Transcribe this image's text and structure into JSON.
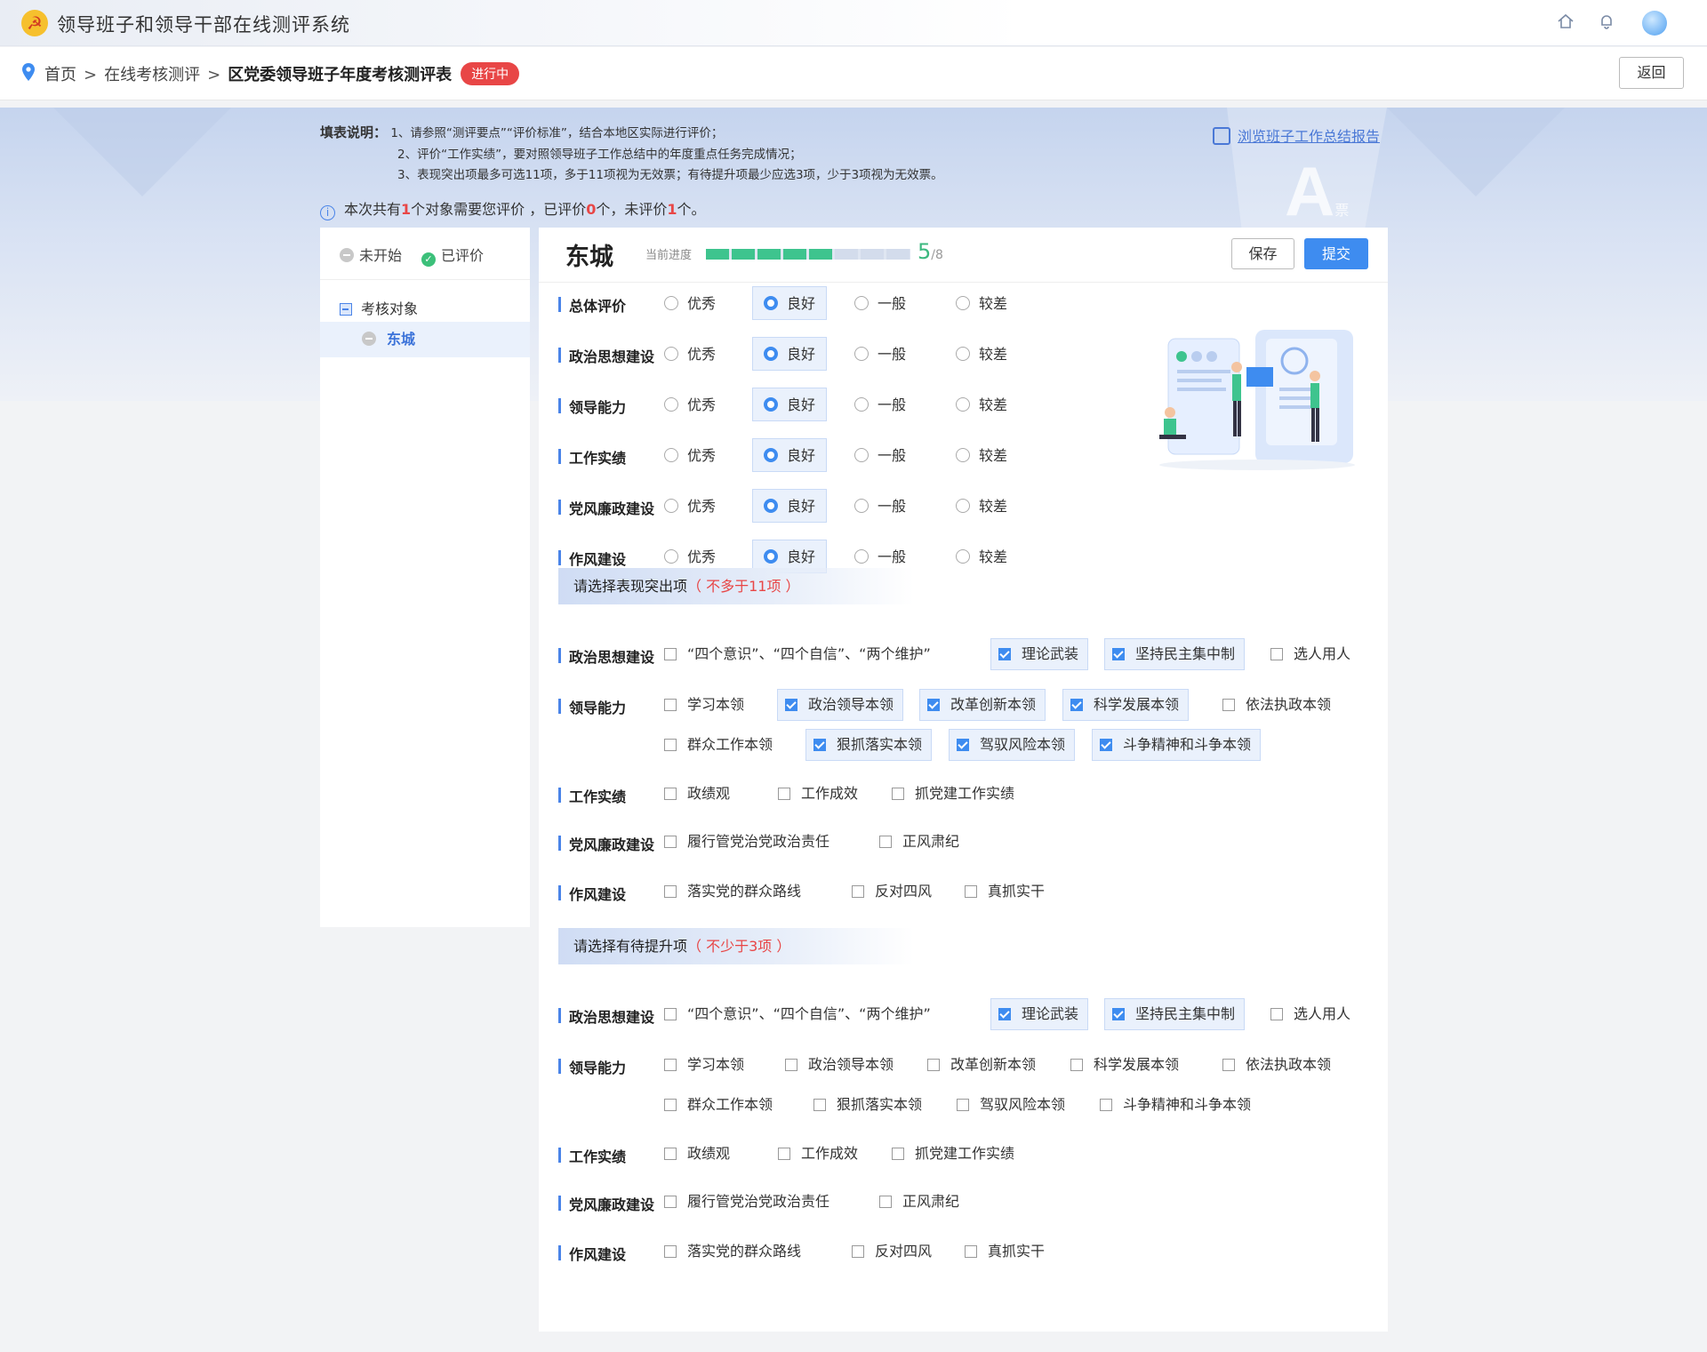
{
  "app": {
    "title": "领导班子和领导干部在线测评系统"
  },
  "breadcrumb": {
    "items": [
      "首页",
      "在线考核测评",
      "区党委领导班子年度考核测评表"
    ],
    "separator": ">",
    "status_badge": "进行中",
    "back_label": "返回"
  },
  "instructions": {
    "lead": "填表说明：",
    "lines": [
      "1、请参照“测评要点”“评价标准”，结合本地区实际进行评价；",
      "2、评价“工作实绩”，要对照领导班子工作总结中的年度重点任务完成情况；",
      "3、表现突出项最多可选11项，多于11项视为无效票；有待提升项最少应选3项，少于3项视为无效票。"
    ],
    "report_link": "浏览班子工作总结报告",
    "watermark": "A",
    "watermark_sub": "票"
  },
  "summary": {
    "prefix": "本次共有",
    "total": "1",
    "mid1": "个对象需要您评价 ，已评价",
    "done": "0",
    "mid2": "个，未评价",
    "todo": "1",
    "suffix": "个。"
  },
  "sidebar": {
    "legend_not_started": "未开始",
    "legend_evaluated": "已评价",
    "tree_root": "考核对象",
    "tree_item": "东城"
  },
  "panel": {
    "subject_name": "东城",
    "progress_label": "当前进度",
    "progress_value": "5",
    "progress_total": "/8",
    "progress_fraction": 0.625,
    "save_label": "保存",
    "submit_label": "提交"
  },
  "ratings": {
    "options": [
      "优秀",
      "良好",
      "一般",
      "较差"
    ],
    "rows": [
      {
        "label": "总体评价",
        "selected": 1
      },
      {
        "label": "政治思想建设",
        "selected": 1
      },
      {
        "label": "领导能力",
        "selected": 1
      },
      {
        "label": "工作实绩",
        "selected": 1
      },
      {
        "label": "党风廉政建设",
        "selected": 1
      },
      {
        "label": "作风建设",
        "selected": 1
      }
    ]
  },
  "outstanding": {
    "title": "请选择表现突出项",
    "hint": "（ 不多于11项 ）",
    "groups": [
      {
        "label": "政治思想建设",
        "items": [
          [
            "“四个意识”、“四个自信”、“两个维护”",
            false
          ],
          [
            "理论武装",
            true
          ],
          [
            "坚持民主集中制",
            true
          ],
          [
            "选人用人",
            false
          ]
        ]
      },
      {
        "label": "领导能力",
        "items": [
          [
            "学习本领",
            false
          ],
          [
            "政治领导本领",
            true
          ],
          [
            "改革创新本领",
            true
          ],
          [
            "科学发展本领",
            true
          ],
          [
            "依法执政本领",
            false
          ],
          [
            "群众工作本领",
            false
          ],
          [
            "狠抓落实本领",
            true
          ],
          [
            "驾驭风险本领",
            true
          ],
          [
            "斗争精神和斗争本领",
            true
          ]
        ]
      },
      {
        "label": "工作实绩",
        "items": [
          [
            "政绩观",
            false
          ],
          [
            "工作成效",
            false
          ],
          [
            "抓党建工作实绩",
            false
          ]
        ]
      },
      {
        "label": "党风廉政建设",
        "items": [
          [
            "履行管党治党政治责任",
            false
          ],
          [
            "正风肃纪",
            false
          ]
        ]
      },
      {
        "label": "作风建设",
        "items": [
          [
            "落实党的群众路线",
            false
          ],
          [
            "反对四风",
            false
          ],
          [
            "真抓实干",
            false
          ]
        ]
      }
    ]
  },
  "improve": {
    "title": "请选择有待提升项",
    "hint": "（ 不少于3项 ）",
    "groups": [
      {
        "label": "政治思想建设",
        "items": [
          [
            "“四个意识”、“四个自信”、“两个维护”",
            false
          ],
          [
            "理论武装",
            true
          ],
          [
            "坚持民主集中制",
            true
          ],
          [
            "选人用人",
            false
          ]
        ]
      },
      {
        "label": "领导能力",
        "items": [
          [
            "学习本领",
            false
          ],
          [
            "政治领导本领",
            false
          ],
          [
            "改革创新本领",
            false
          ],
          [
            "科学发展本领",
            false
          ],
          [
            "依法执政本领",
            false
          ],
          [
            "群众工作本领",
            false
          ],
          [
            "狠抓落实本领",
            false
          ],
          [
            "驾驭风险本领",
            false
          ],
          [
            "斗争精神和斗争本领",
            false
          ]
        ]
      },
      {
        "label": "工作实绩",
        "items": [
          [
            "政绩观",
            false
          ],
          [
            "工作成效",
            false
          ],
          [
            "抓党建工作实绩",
            false
          ]
        ]
      },
      {
        "label": "党风廉政建设",
        "items": [
          [
            "履行管党治党政治责任",
            false
          ],
          [
            "正风肃纪",
            false
          ]
        ]
      },
      {
        "label": "作风建设",
        "items": [
          [
            "落实党的群众路线",
            false
          ],
          [
            "反对四风",
            false
          ],
          [
            "真抓实干",
            false
          ]
        ]
      }
    ]
  },
  "icons": [
    "party-emblem-icon",
    "home-icon",
    "bell-icon",
    "location-pin-icon",
    "report-icon",
    "info-icon",
    "checkbox-icon",
    "radio-icon"
  ],
  "colors": {
    "accent": "#3e8cf0",
    "status_red": "#e84646",
    "progress_green": "#3ec48e"
  }
}
